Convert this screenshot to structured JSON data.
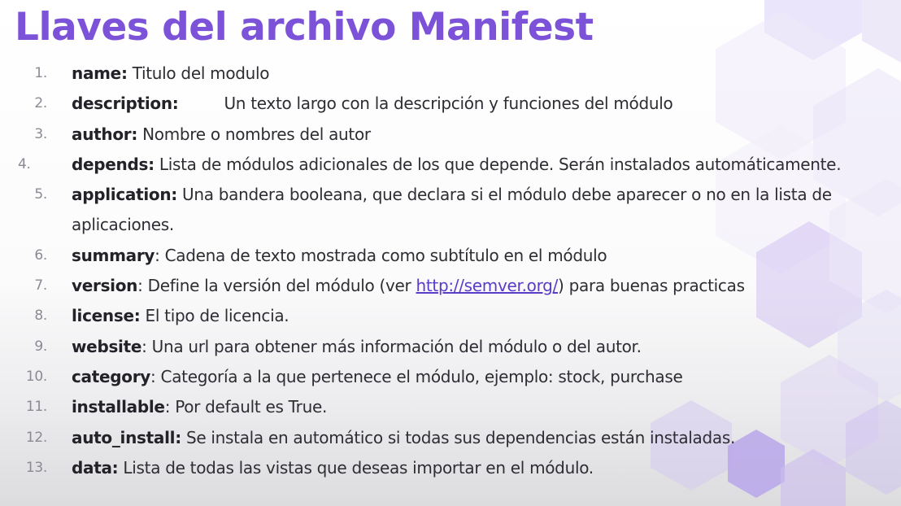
{
  "title": "Llaves del archivo Manifest",
  "colors": {
    "title": "#7b52d8",
    "hexagon_fill": "#b9a6ea",
    "link": "#5a3cc8"
  },
  "items": [
    {
      "num": "1.",
      "key": "name:",
      "desc": " Titulo del modulo"
    },
    {
      "num": "2.",
      "key": "description:",
      "desc": "Un texto largo con la descripción y funciones del módulo"
    },
    {
      "num": "3.",
      "key": "author:",
      "desc": " Nombre o nombres del autor"
    },
    {
      "num": "4.",
      "key": "depends:",
      "desc": " Lista de módulos adicionales de los que depende. Serán instalados automáticamente."
    },
    {
      "num": "5.",
      "key": "application:",
      "desc": " Una bandera booleana, que declara si el módulo debe aparecer o no en la lista de aplicaciones."
    },
    {
      "num": "6.",
      "key": "summary",
      "desc": ": Cadena de texto mostrada como subtítulo en el módulo"
    },
    {
      "num": "7.",
      "key": "version",
      "desc_before": ": Define la versión del módulo (ver ",
      "link": "http://semver.org/",
      "desc_after": ") para buenas practicas"
    },
    {
      "num": "8.",
      "key": "license:",
      "desc": " El tipo de licencia."
    },
    {
      "num": "9.",
      "key": "website",
      "desc": ": Una url para obtener más información del módulo o del autor."
    },
    {
      "num": "10.",
      "key": "category",
      "desc": ": Categoría a la que pertenece el módulo, ejemplo: stock, purchase"
    },
    {
      "num": "11.",
      "key": "installable",
      "desc": ": Por default es True."
    },
    {
      "num": "12.",
      "key": "auto_install:",
      "desc": " Se instala en automático si todas sus dependencias están instaladas."
    },
    {
      "num": "13.",
      "key": "data:",
      "desc": " Lista de todas las vistas que deseas importar en el módulo."
    }
  ]
}
